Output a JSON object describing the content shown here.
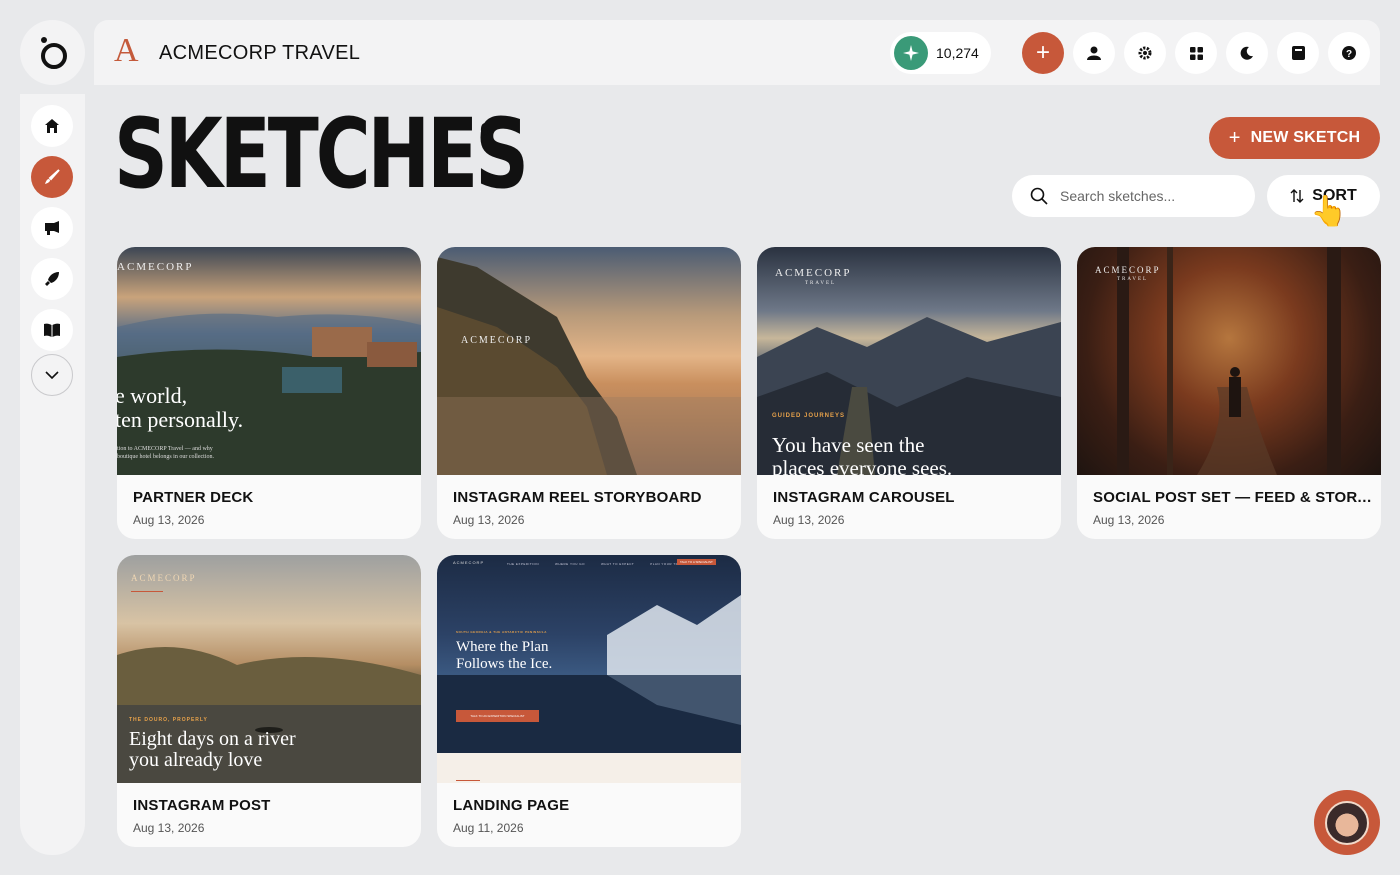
{
  "brand": {
    "mark": "A",
    "name": "ACMECORP TRAVEL"
  },
  "credits": {
    "value": "10,274"
  },
  "header_actions": [
    {
      "icon": "plus-icon"
    },
    {
      "icon": "user-icon"
    },
    {
      "icon": "gear-icon"
    },
    {
      "icon": "grid-icon"
    },
    {
      "icon": "moon-icon"
    },
    {
      "icon": "book-icon"
    },
    {
      "icon": "help-icon"
    }
  ],
  "sidebar": [
    {
      "icon": "home-icon",
      "active": false
    },
    {
      "icon": "brush-icon",
      "active": true
    },
    {
      "icon": "megaphone-icon",
      "active": false
    },
    {
      "icon": "rocket-icon",
      "active": false
    },
    {
      "icon": "open-book-icon",
      "active": false
    },
    {
      "icon": "chevron-down-icon",
      "active": false
    }
  ],
  "page": {
    "title": "SKETCHES",
    "count": "6"
  },
  "actions": {
    "new_label": "NEW SKETCH",
    "sort_label": "SORT",
    "search_placeholder": "Search sketches..."
  },
  "colors": {
    "accent": "#c7583a",
    "credits": "#3a9a78",
    "background": "#e8e9eb"
  },
  "cards": [
    {
      "title": "PARTNER DECK",
      "date": "Aug 13, 2026",
      "thumb": {
        "brand": "ACMECORP",
        "headline1": "e world,",
        "headline2": "ten personally.",
        "body": "tion to ACMECORP Travel — and why boutique hotel belongs in our collection."
      }
    },
    {
      "title": "INSTAGRAM REEL STORYBOARD",
      "date": "Aug 13, 2026",
      "thumb": {
        "brand": "ACMECORP"
      }
    },
    {
      "title": "INSTAGRAM CAROUSEL",
      "date": "Aug 13, 2026",
      "thumb": {
        "brand": "ACMECORP",
        "sub": "TRAVEL",
        "eyebrow": "GUIDED JOURNEYS",
        "headline1": "You have seen the",
        "headline2": "places everyone sees."
      }
    },
    {
      "title": "SOCIAL POST SET — FEED & STORY ...",
      "date": "Aug 13, 2026",
      "thumb": {
        "brand": "ACMECORP",
        "sub": "TRAVEL"
      }
    },
    {
      "title": "INSTAGRAM POST",
      "date": "Aug 13, 2026",
      "thumb": {
        "brand": "ACMECORP",
        "eyebrow": "THE DOURO, PROPERLY",
        "headline1": "Eight days on a river",
        "headline2": "you already love"
      }
    },
    {
      "title": "LANDING PAGE",
      "date": "Aug 11, 2026",
      "thumb": {
        "brand": "ACMECORP",
        "nav": [
          "THE EXPEDITION",
          "WHERE YOU GO",
          "WHAT TO EXPECT",
          "PLAN YOUR TRIP"
        ],
        "nav_cta": "TALK TO A SPECIALIST",
        "eyebrow": "SOUTH GEORGIA & THE ANTARCTIC PENINSULA",
        "headline1": "Where the Plan",
        "headline2": "Follows the Ice.",
        "cta": "TALK TO AN EXPEDITION SPECIALIST"
      }
    }
  ]
}
